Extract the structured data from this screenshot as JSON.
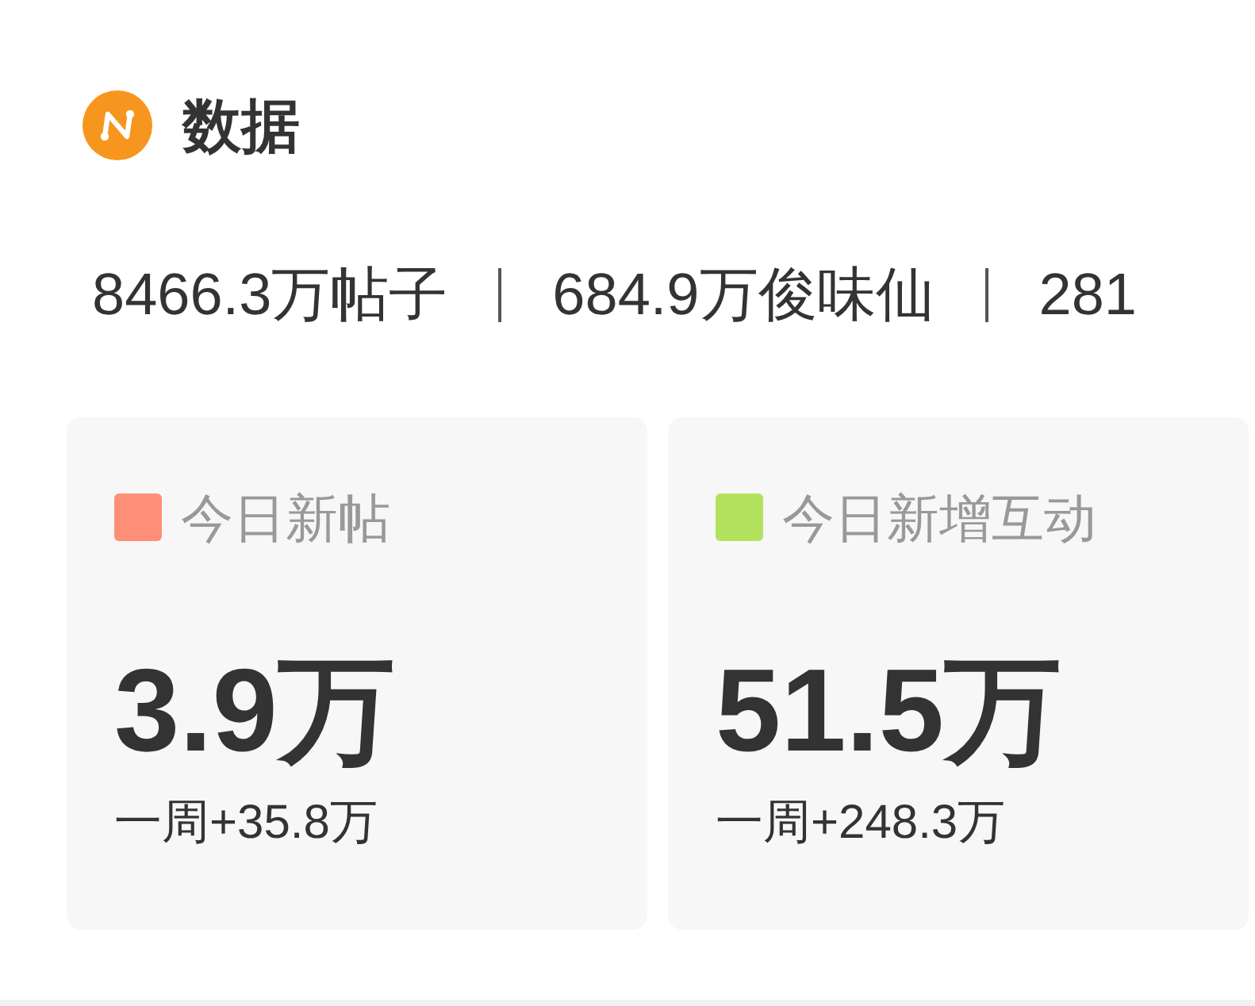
{
  "section": {
    "title": "数据"
  },
  "stats": [
    "8466.3万帖子",
    "684.9万俊味仙",
    "281"
  ],
  "cards": [
    {
      "label": "今日新帖",
      "color": "#fd8f78",
      "value": "3.9万",
      "weekly": "一周+35.8万"
    },
    {
      "label": "今日新增互动",
      "color": "#b3e35e",
      "value": "51.5万",
      "weekly": "一周+248.3万"
    }
  ]
}
